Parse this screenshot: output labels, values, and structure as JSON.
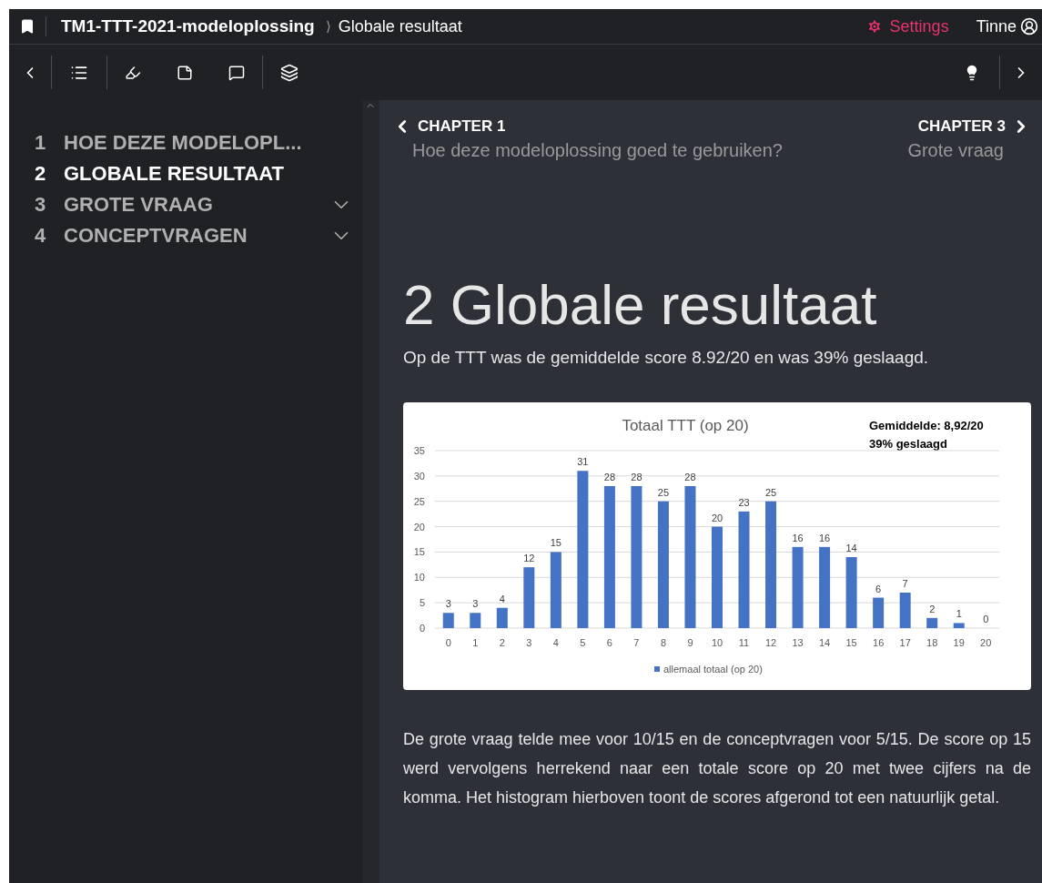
{
  "topbar": {
    "book_title": "TM1-TTT-2021-modeloplossing",
    "separator": "⟩",
    "page_title": "Globale resultaat",
    "settings": "Settings",
    "user": "Tinne"
  },
  "sidebar": {
    "items": [
      {
        "number": "1",
        "label": "HOE DEZE MODELOPL...",
        "selected": false,
        "expandable": false
      },
      {
        "number": "2",
        "label": "GLOBALE RESULTAAT",
        "selected": true,
        "expandable": false
      },
      {
        "number": "3",
        "label": "GROTE VRAAG",
        "selected": false,
        "expandable": true
      },
      {
        "number": "4",
        "label": "CONCEPTVRAGEN",
        "selected": false,
        "expandable": true
      }
    ]
  },
  "nav": {
    "prev": {
      "label": "CHAPTER 1",
      "title": "Hoe deze modeloplossing goed te gebruiken?"
    },
    "next": {
      "label": "CHAPTER 3",
      "title": "Grote vraag"
    }
  },
  "heading": "2 Globale resultaat",
  "intro": "Op de TTT was de gemiddelde score 8.92/20 en was 39% geslaagd.",
  "figure": {
    "chart_data": {
      "type": "bar",
      "title": "Totaal TTT (op 20)",
      "categories": [
        "0",
        "1",
        "2",
        "3",
        "4",
        "5",
        "6",
        "7",
        "8",
        "9",
        "10",
        "11",
        "12",
        "13",
        "14",
        "15",
        "16",
        "17",
        "18",
        "19",
        "20"
      ],
      "series": [
        {
          "name": "allemaal totaal (op 20)",
          "color": "#4472c4",
          "values": [
            3,
            3,
            4,
            12,
            15,
            31,
            28,
            28,
            25,
            28,
            20,
            23,
            25,
            16,
            16,
            14,
            6,
            7,
            2,
            1,
            0
          ]
        }
      ],
      "ylim": [
        0,
        35
      ],
      "grid": true,
      "yticks": [
        0,
        5,
        10,
        15,
        20,
        25,
        30,
        35
      ],
      "data_labels": true,
      "annotations": [
        "Gemiddelde: 8,92/20",
        "39% geslaagd"
      ]
    }
  },
  "body": "De grote vraag telde mee voor 10/15 en de conceptvragen voor 5/15. De score op 15 werd vervolgens herrekend naar een totale score op 20 met twee cijfers na de komma. Het histogram hierboven toont de scores afgerond tot een natuurlijk getal."
}
